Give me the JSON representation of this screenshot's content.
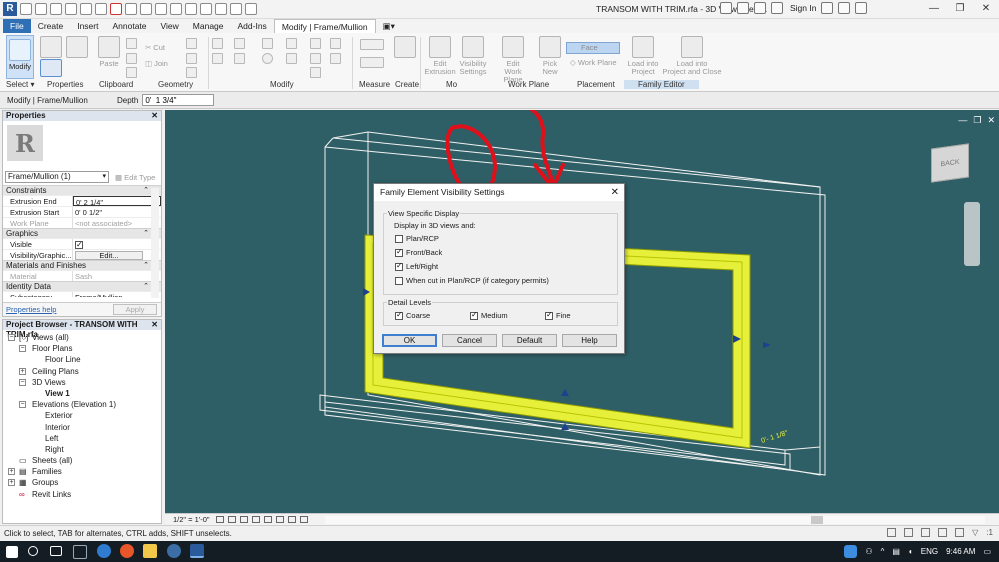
{
  "window": {
    "title": "TRANSOM WITH TRIM.rfa - 3D View: View 1",
    "sign_in": "Sign In",
    "controls": [
      "—",
      "❐",
      "✕"
    ]
  },
  "menu": {
    "tabs": [
      "File",
      "Create",
      "Insert",
      "Annotate",
      "View",
      "Manage",
      "Add-Ins",
      "Modify | Frame/Mullion"
    ],
    "active": "Modify | Frame/Mullion"
  },
  "ribbon": {
    "modify_label": "Modify",
    "select_label": "Select",
    "properties_label": "Properties",
    "paste_label": "Paste",
    "cut_label": "Cut",
    "join_label": "Join",
    "edit_extrusion_label": "Edit\nExtrusion",
    "visibility_settings_label": "Visibility\nSettings",
    "edit_work_plane_label": "Edit\nWork Plane",
    "pick_new_label": "Pick\nNew",
    "face_label": "Face",
    "work_plane_label": "Work Plane",
    "load_into_project_label": "Load into\nProject",
    "load_close_label": "Load into\nProject and Close",
    "panels": {
      "select": "Select ▾",
      "properties": "Properties",
      "clipboard": "Clipboard",
      "geometry": "Geometry",
      "modify": "Modify",
      "measure": "Measure",
      "create": "Create",
      "mode": "Mo",
      "work_plane": "Work Plane",
      "placement": "Placement",
      "family_editor": "Family Editor"
    }
  },
  "options_bar": {
    "context": "Modify | Frame/Mullion",
    "depth_label": "Depth",
    "depth_value": "0'  1 3/4\""
  },
  "properties": {
    "title": "Properties",
    "type_selector": "Frame/Mullion (1)",
    "edit_type": "Edit Type",
    "sections": {
      "constraints": "Constraints",
      "graphics": "Graphics",
      "materials": "Materials and Finishes",
      "identity": "Identity Data"
    },
    "rows": {
      "extrusion_end": {
        "key": "Extrusion End",
        "value": "0'  2 1/4\""
      },
      "extrusion_start": {
        "key": "Extrusion Start",
        "value": "0'  0 1/2\""
      },
      "work_plane": {
        "key": "Work Plane",
        "value": "<not associated>"
      },
      "visible": {
        "key": "Visible"
      },
      "visibility_graphics": {
        "key": "Visibility/Graphic...",
        "value": "Edit..."
      },
      "material": {
        "key": "Material",
        "value": "Sash"
      },
      "subcategory": {
        "key": "Subcategory",
        "value": "Frame/Mullion"
      }
    },
    "help_link": "Properties help",
    "apply": "Apply"
  },
  "project_browser": {
    "title": "Project Browser - TRANSOM WITH TRIM.rfa",
    "nodes": [
      {
        "label": "Views (all)"
      },
      {
        "label": "Floor Plans"
      },
      {
        "label": "Floor Line"
      },
      {
        "label": "Ceiling Plans"
      },
      {
        "label": "3D Views"
      },
      {
        "label": "View 1"
      },
      {
        "label": "Elevations (Elevation 1)"
      },
      {
        "label": "Exterior"
      },
      {
        "label": "Interior"
      },
      {
        "label": "Left"
      },
      {
        "label": "Right"
      },
      {
        "label": "Sheets (all)"
      },
      {
        "label": "Families"
      },
      {
        "label": "Groups"
      },
      {
        "label": "Revit Links"
      }
    ]
  },
  "viewcube": {
    "face": "BACK"
  },
  "dimension_text": "0'- 1 1/8\"",
  "dialog": {
    "title": "Family Element Visibility Settings",
    "group1_title": "View Specific Display",
    "group1_subtitle": "Display in 3D views and:",
    "checks": [
      {
        "label": "Plan/RCP",
        "checked": false
      },
      {
        "label": "Front/Back",
        "checked": true
      },
      {
        "label": "Left/Right",
        "checked": true
      },
      {
        "label": "When cut in Plan/RCP (if category permits)",
        "checked": false
      }
    ],
    "group2_title": "Detail Levels",
    "levels": [
      {
        "label": "Coarse",
        "checked": true
      },
      {
        "label": "Medium",
        "checked": true
      },
      {
        "label": "Fine",
        "checked": true
      }
    ],
    "buttons": {
      "ok": "OK",
      "cancel": "Cancel",
      "default": "Default",
      "help": "Help"
    }
  },
  "view_control": {
    "scale": "1/2\" = 1'-0\""
  },
  "status": {
    "message": "Click to select, TAB for alternates, CTRL adds, SHIFT unselects.",
    "filter": ":1"
  },
  "taskbar": {
    "language": "ENG",
    "time": "9:46 AM"
  },
  "colors": {
    "viewport_bg": "#2f5f66",
    "frame_yellow": "#e6f03a",
    "annotation_red": "#e0101a",
    "accent_blue": "#2f6fb5"
  }
}
